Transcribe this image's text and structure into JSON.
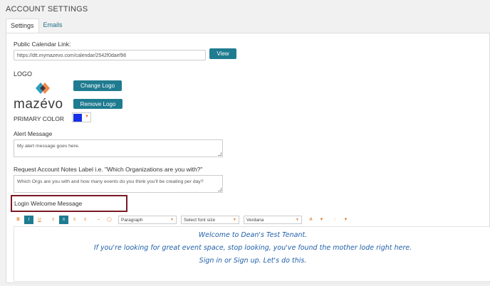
{
  "page": {
    "title": "ACCOUNT SETTINGS"
  },
  "tabs": [
    {
      "label": "Settings"
    },
    {
      "label": "Emails"
    }
  ],
  "calendar": {
    "label": "Public Calendar Link:",
    "value": "https://dtt.mymazevo.com/calendar/2542f0daef96",
    "view_button": "View"
  },
  "logo": {
    "label": "LOGO",
    "wordmark": "mazévo",
    "change_button": "Change Logo",
    "remove_button": "Remove Logo"
  },
  "primary_color": {
    "label": "PRIMARY COLOR",
    "value": "#1530e6"
  },
  "alert": {
    "label": "Alert Message",
    "value": "My alert message goes here."
  },
  "notes": {
    "label": "Request Account Notes Label i.e. \"Which Organizations are you with?\"",
    "value": "Which Orgs are you with and how many events do you think you'll be creating per day?"
  },
  "login": {
    "label": "Login Welcome Message",
    "toolbar": {
      "bold": "B",
      "italic": "I",
      "underline": "U",
      "align_left": "≡",
      "align_center": "≡",
      "align_right": "≡",
      "align_justify": "≡",
      "link": "⇔",
      "image": "◯",
      "paragraph": "Paragraph",
      "font_size": "Select font size",
      "font_family": "Verdana",
      "text_color": "A",
      "highlight": "◌"
    },
    "lines": [
      "Welcome to Dean's Test Tenant.",
      "If you're looking for great event space, stop looking, you've found the mother lode right here.",
      "Sign in or Sign up.  Let's do this."
    ]
  }
}
